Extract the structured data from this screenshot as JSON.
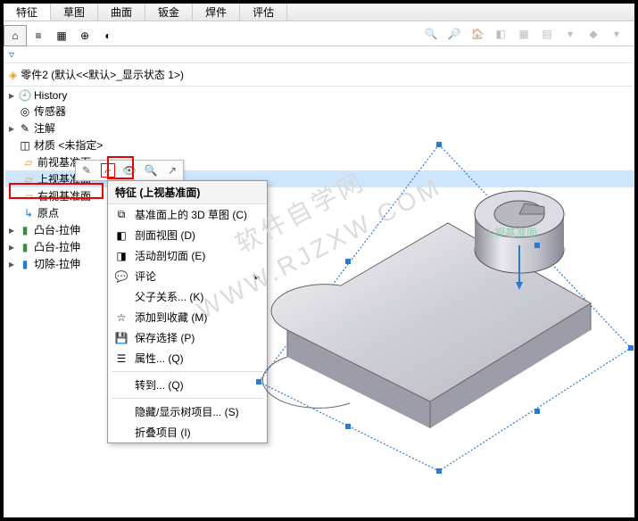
{
  "tabs": [
    "特征",
    "草图",
    "曲面",
    "钣金",
    "焊件",
    "评估"
  ],
  "activeTab": 0,
  "viewTools": [
    "zoom",
    "zoom-area",
    "house",
    "cube",
    "layers",
    "box",
    "dropdown",
    "gem",
    "dropdown"
  ],
  "panelTabs": [
    "design",
    "list",
    "grid",
    "target",
    "appearance"
  ],
  "partTitle": "零件2 (默认<<默认>_显示状态 1>)",
  "tree": [
    {
      "exp": "▸",
      "icon": "hist",
      "label": "History"
    },
    {
      "exp": "",
      "icon": "sens",
      "label": "传感器"
    },
    {
      "exp": "▸",
      "icon": "anno",
      "label": "注解"
    },
    {
      "exp": "",
      "icon": "mat",
      "label": "材质 <未指定>"
    },
    {
      "exp": "",
      "icon": "plane",
      "label": "前视基准面",
      "indent": true
    },
    {
      "exp": "",
      "icon": "plane",
      "label": "上视基准面",
      "indent": true,
      "hl": true
    },
    {
      "exp": "",
      "icon": "plane",
      "label": "右视基准面",
      "indent": true
    },
    {
      "exp": "",
      "icon": "origin",
      "label": "原点",
      "indent": true
    },
    {
      "exp": "▸",
      "icon": "ext",
      "label": "凸台-拉伸"
    },
    {
      "exp": "▸",
      "icon": "ext",
      "label": "凸台-拉伸"
    },
    {
      "exp": "▸",
      "icon": "cut",
      "label": "切除-拉伸"
    }
  ],
  "miniToolbarHint": "context-toolbar",
  "contextHeader": "特征 (上视基准面)",
  "contextItems": [
    {
      "icon": "sk3d",
      "label": "基准面上的 3D 草图 (C)"
    },
    {
      "icon": "sec",
      "label": "剖面视图 (D)"
    },
    {
      "icon": "live",
      "label": "活动剖切面 (E)"
    },
    {
      "icon": "cmt",
      "label": "评论",
      "arrow": true
    },
    {
      "icon": "par",
      "label": "父子关系... (K)"
    },
    {
      "icon": "fav",
      "label": "添加到收藏 (M)"
    },
    {
      "icon": "save",
      "label": "保存选择 (P)"
    },
    {
      "icon": "prop",
      "label": "属性... (Q)"
    },
    {
      "sep": true
    },
    {
      "icon": "",
      "label": "转到... (Q)"
    },
    {
      "sep": true
    },
    {
      "icon": "",
      "label": "隐藏/显示树项目... (S)"
    },
    {
      "icon": "",
      "label": "折叠项目 (I)"
    }
  ],
  "watermark": "软件自学网\nWWW.RJZXW.COM",
  "plane_label": "上视基准面"
}
